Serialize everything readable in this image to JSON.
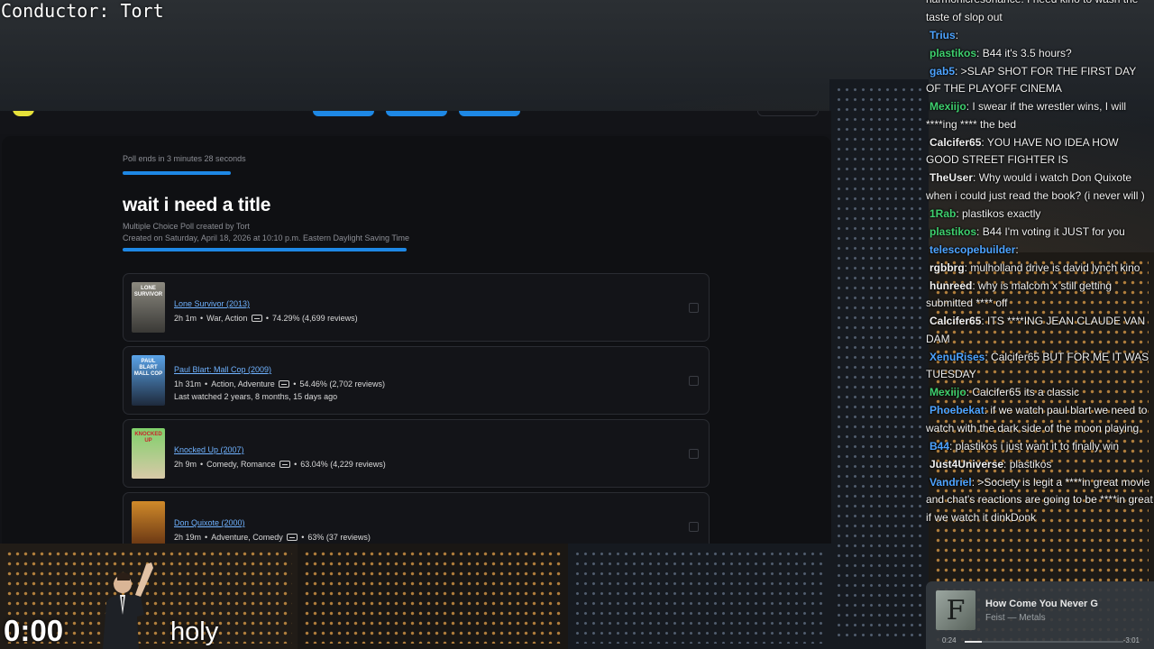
{
  "overlay": {
    "conductor": "Conductor: Tort",
    "timer": "0:00",
    "caption": "holy"
  },
  "poll": {
    "ends_text": "Poll ends in 3 minutes 28 seconds",
    "time_remaining_fraction": 0.19,
    "title": "wait i need a title",
    "meta_type": "Multiple Choice Poll created by Tort",
    "meta_created": "Created on Saturday, April 18, 2026 at 10:10 p.m. Eastern Daylight Saving Time",
    "options": [
      {
        "title": "Lone Survivor (2013)",
        "runtime": "2h 1m",
        "genres": "War, Action",
        "score": "74.29% (4,699 reviews)",
        "extra": "",
        "poster_text": "LONE SURVIVOR",
        "poster_color": "#6c6c66"
      },
      {
        "title": "Paul Blart: Mall Cop (2009)",
        "runtime": "1h 31m",
        "genres": "Action, Adventure",
        "score": "54.46% (2,702 reviews)",
        "extra": "Last watched 2 years, 8 months, 15 days ago",
        "poster_text": "PAUL BLART MALL COP",
        "poster_color": "#4a8fd6"
      },
      {
        "title": "Knocked Up (2007)",
        "runtime": "2h 9m",
        "genres": "Comedy, Romance",
        "score": "63.04% (4,229 reviews)",
        "extra": "",
        "poster_text": "KNOCKED UP",
        "poster_color": "#6bbf4e"
      },
      {
        "title": "Don Quixote (2000)",
        "runtime": "2h 19m",
        "genres": "Adventure, Comedy",
        "score": "63% (37 reviews)",
        "extra": "",
        "poster_text": "",
        "poster_color": "#b86a1e"
      }
    ]
  },
  "chat": {
    "messages": [
      {
        "user": "",
        "user_color": "#f0f0f0",
        "text": "harmonicresonance: I need kino to wash the taste of slop out"
      },
      {
        "user": "Trius",
        "user_color": "#4da3ff",
        "text": ":"
      },
      {
        "user": "plastikos",
        "user_color": "#3ecf6e",
        "text": ": B44 it's 3.5 hours?"
      },
      {
        "user": "gab5",
        "user_color": "#4da3ff",
        "text": ": >SLAP SHOT FOR THE FIRST DAY OF THE PLAYOFF CINEMA"
      },
      {
        "user": "Mexiijo",
        "user_color": "#3ecf6e",
        "text": ": I swear if the wrestler wins, I will ****ing **** the bed"
      },
      {
        "user": "Calcifer65",
        "user_color": "#f0f0f0",
        "text": ": YOU HAVE NO IDEA HOW GOOD STREET FIGHTER IS"
      },
      {
        "user": "TheUser",
        "user_color": "#f0f0f0",
        "text": ": Why would i watch Don Quixote when i could just read the book? (i never will )"
      },
      {
        "user": "1Rab",
        "user_color": "#3ecf6e",
        "text": ": plastikos exactly"
      },
      {
        "user": "plastikos",
        "user_color": "#3ecf6e",
        "text": ": B44 I'm voting it JUST for you"
      },
      {
        "user": "telescopebuilder",
        "user_color": "#4da3ff",
        "text": ":"
      },
      {
        "user": "rgbbrg",
        "user_color": "#f0f0f0",
        "text": ": mulholland drive is david lynch kino"
      },
      {
        "user": "hunreed",
        "user_color": "#f0f0f0",
        "text": ": why is malcom x still getting submitted **** off"
      },
      {
        "user": "Calcifer65",
        "user_color": "#f0f0f0",
        "text": ": ITS ****ING JEAN CLAUDE VAN DAM"
      },
      {
        "user": "XenuRises",
        "user_color": "#4da3ff",
        "text": ": Calcifer65 BUT FOR ME IT WAS TUESDAY"
      },
      {
        "user": "Mexiijo",
        "user_color": "#3ecf6e",
        "text": ": Calcifer65 its a classic"
      },
      {
        "user": "Phoebekat",
        "user_color": "#4da3ff",
        "text": ": if we watch paul blart we need to watch with the dark side of the moon playing"
      },
      {
        "user": "B44",
        "user_color": "#4da3ff",
        "text": ": plastikos i just want it to finally win"
      },
      {
        "user": "Just4Universe",
        "user_color": "#f0f0f0",
        "text": ": plastikos"
      },
      {
        "user": "Vandriel",
        "user_color": "#4da3ff",
        "text": ": >Society is legit a ****in great movie and chat's reactions are going to be ****in great if we watch it dinkDonk"
      }
    ]
  },
  "music": {
    "title": "How Come You Never G",
    "artist": "Feist — Metals",
    "time_current": "0:24",
    "time_remaining": "-3:01",
    "progress_fraction": 0.11,
    "album_letter": "F"
  }
}
